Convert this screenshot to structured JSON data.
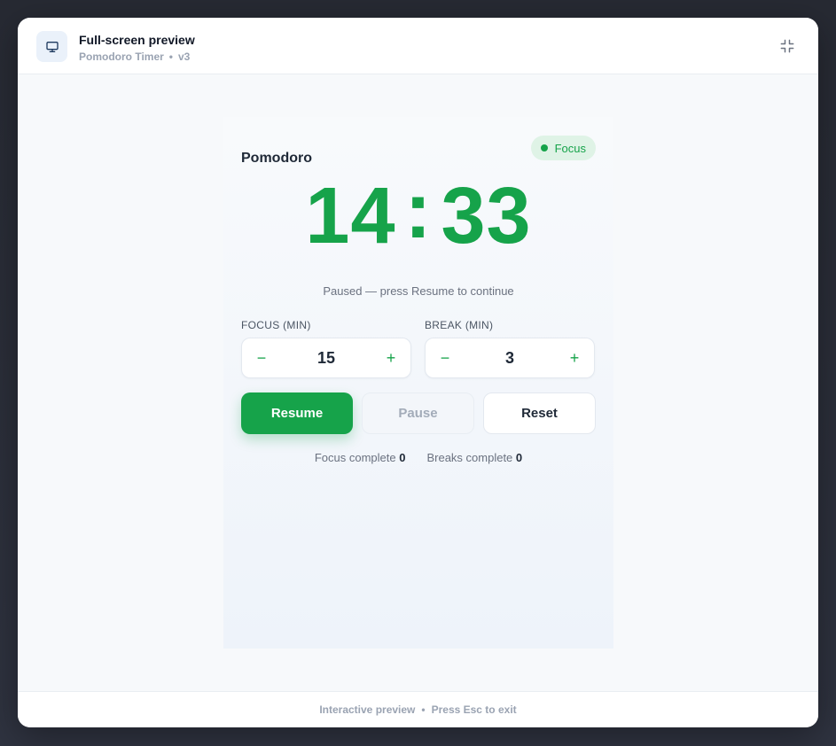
{
  "modal": {
    "title": "Full-screen preview",
    "app_name": "Pomodoro Timer",
    "separator": "•",
    "version": "v3",
    "header_icon": "monitor-icon",
    "exit_icon": "minimize-icon"
  },
  "footer": {
    "left": "Interactive preview",
    "separator": "•",
    "right": "Press Esc to exit"
  },
  "app": {
    "title": "Pomodoro",
    "mode_badge": "Focus",
    "timer": {
      "minutes": "14",
      "colon": ":",
      "seconds": "33"
    },
    "status": "Paused — press Resume to continue",
    "focus": {
      "label": "FOCUS (MIN)",
      "value": "15",
      "minus": "−",
      "plus": "+"
    },
    "break": {
      "label": "BREAK (MIN)",
      "value": "3",
      "minus": "−",
      "plus": "+"
    },
    "buttons": {
      "resume": "Resume",
      "pause": "Pause",
      "reset": "Reset"
    },
    "counts": {
      "focus_label": "Focus complete",
      "focus_value": "0",
      "breaks_label": "Breaks complete",
      "breaks_value": "0"
    }
  },
  "colors": {
    "accent": "#16a34a",
    "badge_bg": "#dff3e6",
    "text_dark": "#1f2937",
    "text_muted": "#6b7280"
  }
}
